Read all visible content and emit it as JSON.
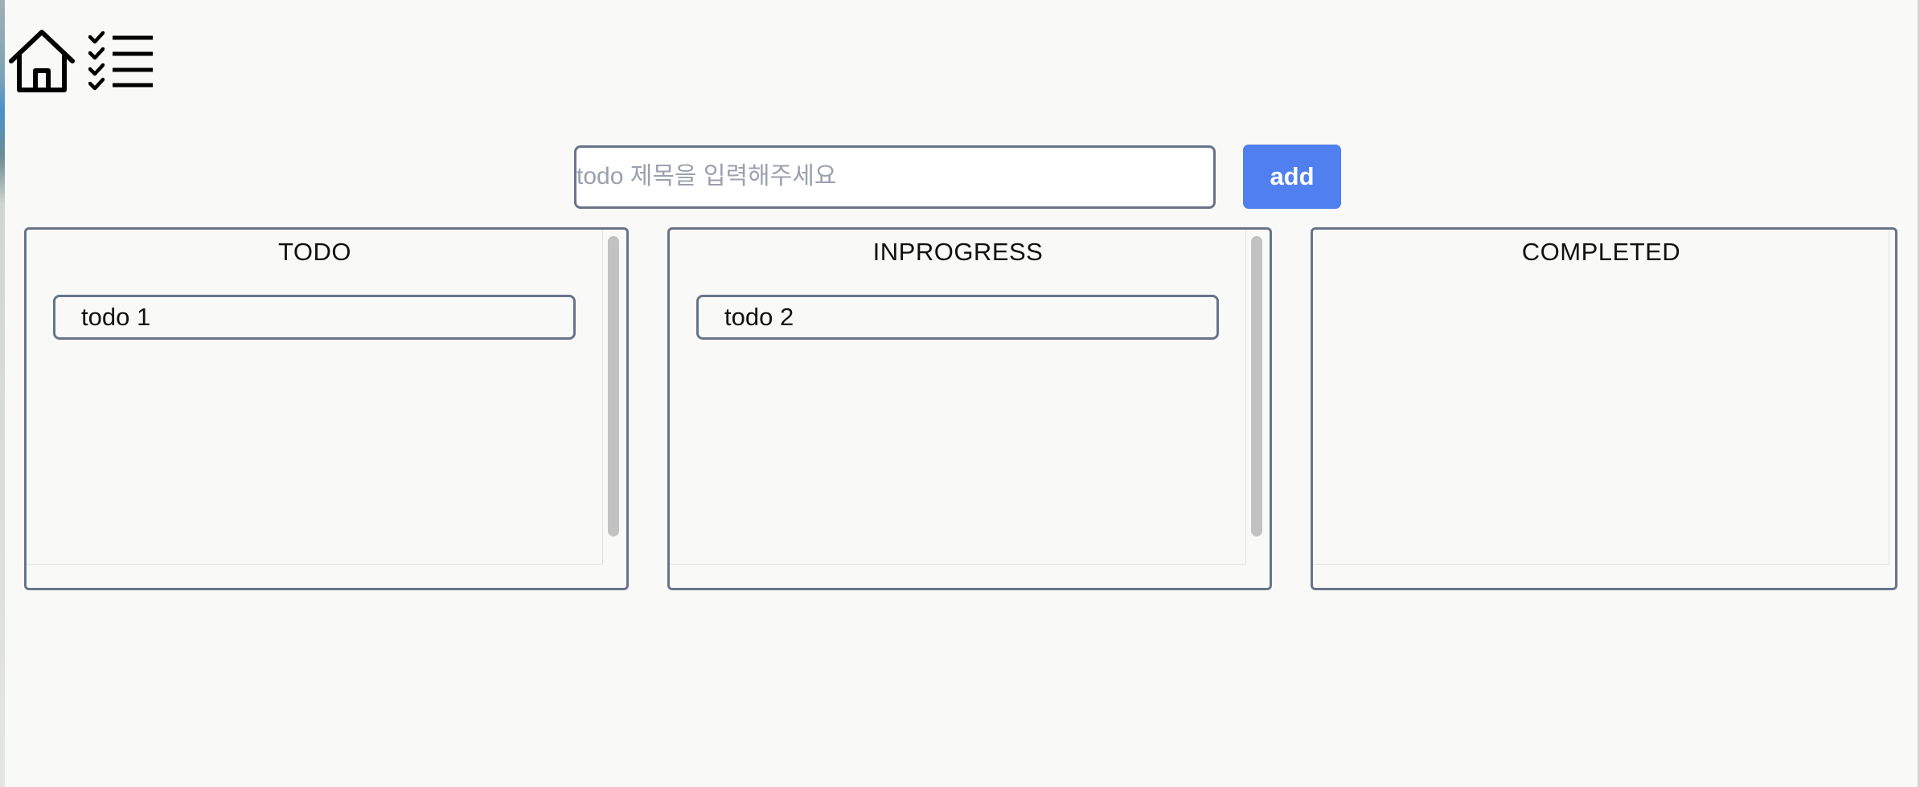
{
  "nav": {
    "home_icon": "home-icon",
    "list_icon": "checklist-icon"
  },
  "add_form": {
    "input_value": "",
    "input_placeholder": "todo 제목을 입력해주세요",
    "add_label": "add",
    "accent_color": "#5080ef"
  },
  "board": {
    "columns": [
      {
        "title": "TODO",
        "cards": [
          "todo 1"
        ]
      },
      {
        "title": "INPROGRESS",
        "cards": [
          "todo 2"
        ]
      },
      {
        "title": "COMPLETED",
        "cards": []
      }
    ],
    "border_color": "#687489"
  }
}
